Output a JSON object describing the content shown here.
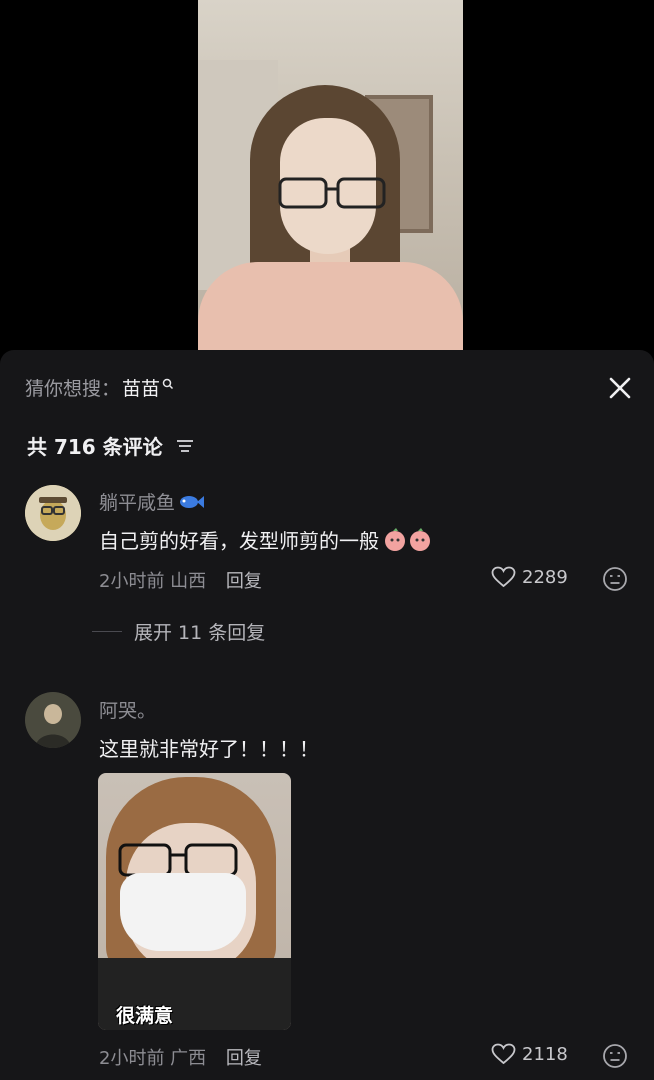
{
  "search_suggest": {
    "prefix": "猜你想搜：",
    "keyword": "苗苗"
  },
  "comments_header": {
    "count_text": "共 716 条评论"
  },
  "comments": [
    {
      "user": "躺平咸鱼",
      "text": "自己剪的好看，发型师剪的一般",
      "time_location": "2小时前 山西",
      "reply_label": "回复",
      "likes": "2289",
      "expand_label": "展开 11 条回复"
    },
    {
      "user": "阿哭。",
      "text": "这里就非常好了！！！！",
      "image_caption": "很满意",
      "time_location": "2小时前 广西",
      "reply_label": "回复",
      "likes": "2118"
    }
  ]
}
